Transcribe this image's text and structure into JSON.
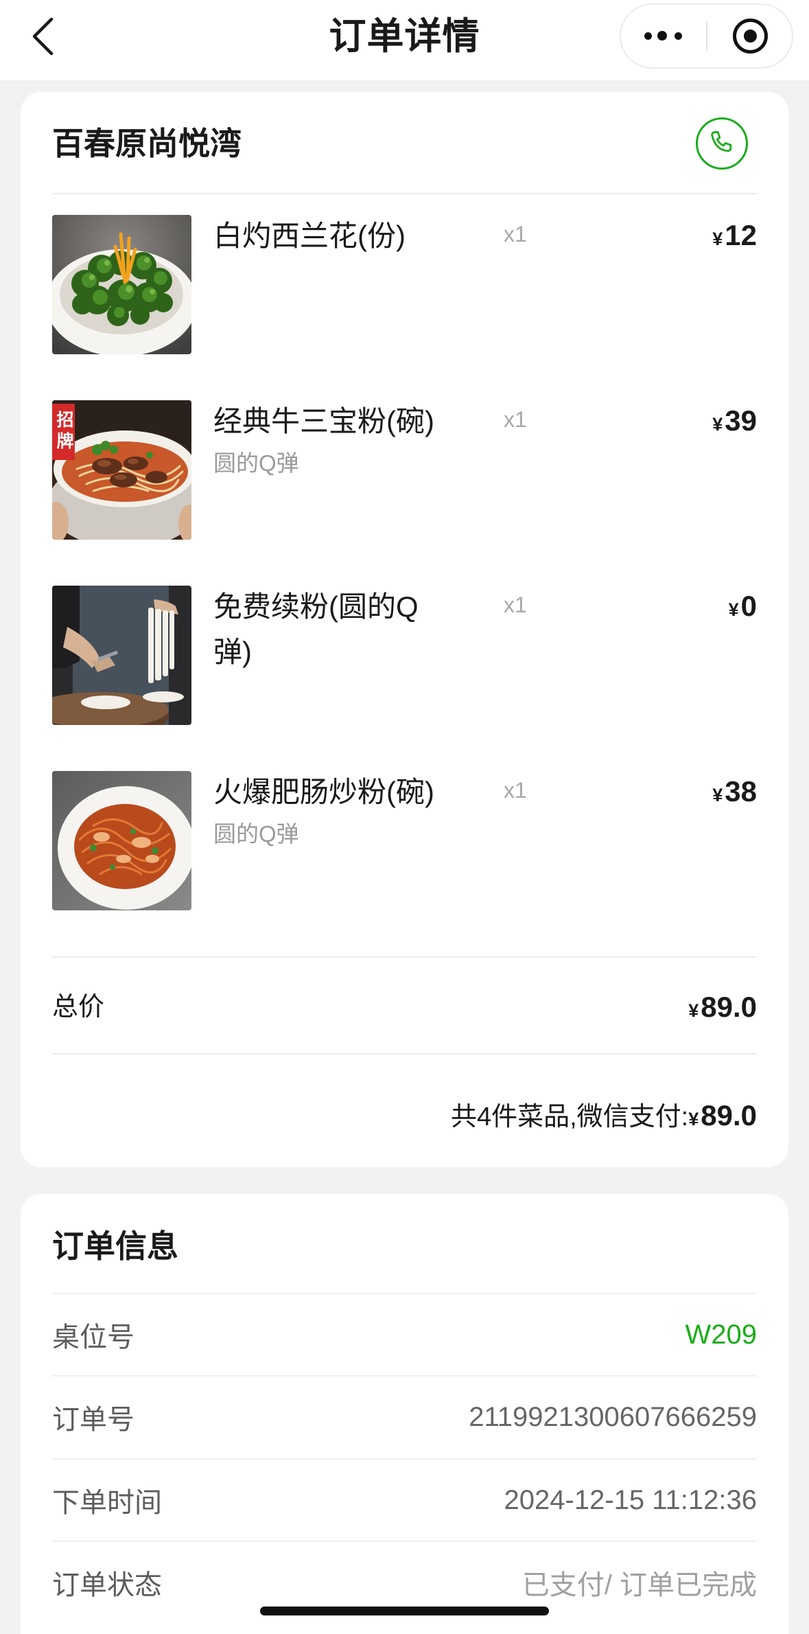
{
  "nav": {
    "title": "订单详情",
    "back_icon": "chevron-left-icon",
    "more_icon": "more-dots-icon",
    "exit_icon": "record-circle-icon"
  },
  "store": {
    "name": "百春原尚悦湾",
    "phone_icon": "phone-icon"
  },
  "currency": "¥",
  "items": [
    {
      "name": "白灼西兰花(份)",
      "qty": "x1",
      "price": "12"
    },
    {
      "name": "经典牛三宝粉(碗)",
      "spec": "圆的Q弹",
      "qty": "x1",
      "price": "39",
      "image_tag": "招牌"
    },
    {
      "name": "免费续粉(圆的Q弹)",
      "qty": "x1",
      "price": "0"
    },
    {
      "name": "火爆肥肠炒粉(碗)",
      "spec": "圆的Q弹",
      "qty": "x1",
      "price": "38"
    }
  ],
  "total": {
    "label": "总价",
    "amount": "89.0"
  },
  "summary": {
    "text": "共4件菜品,微信支付:",
    "amount": "89.0"
  },
  "order_info": {
    "title": "订单信息",
    "rows": [
      {
        "label": "桌位号",
        "value": "W209"
      },
      {
        "label": "订单号",
        "value": "2119921300607666259"
      },
      {
        "label": "下单时间",
        "value": "2024-12-15 11:12:36"
      },
      {
        "label": "订单状态",
        "value": "已支付/ 订单已完成"
      }
    ]
  },
  "colors": {
    "background": "#f2f2f2",
    "card": "#ffffff",
    "text_primary": "#1a1a1a",
    "accent_green": "#1aad19"
  }
}
